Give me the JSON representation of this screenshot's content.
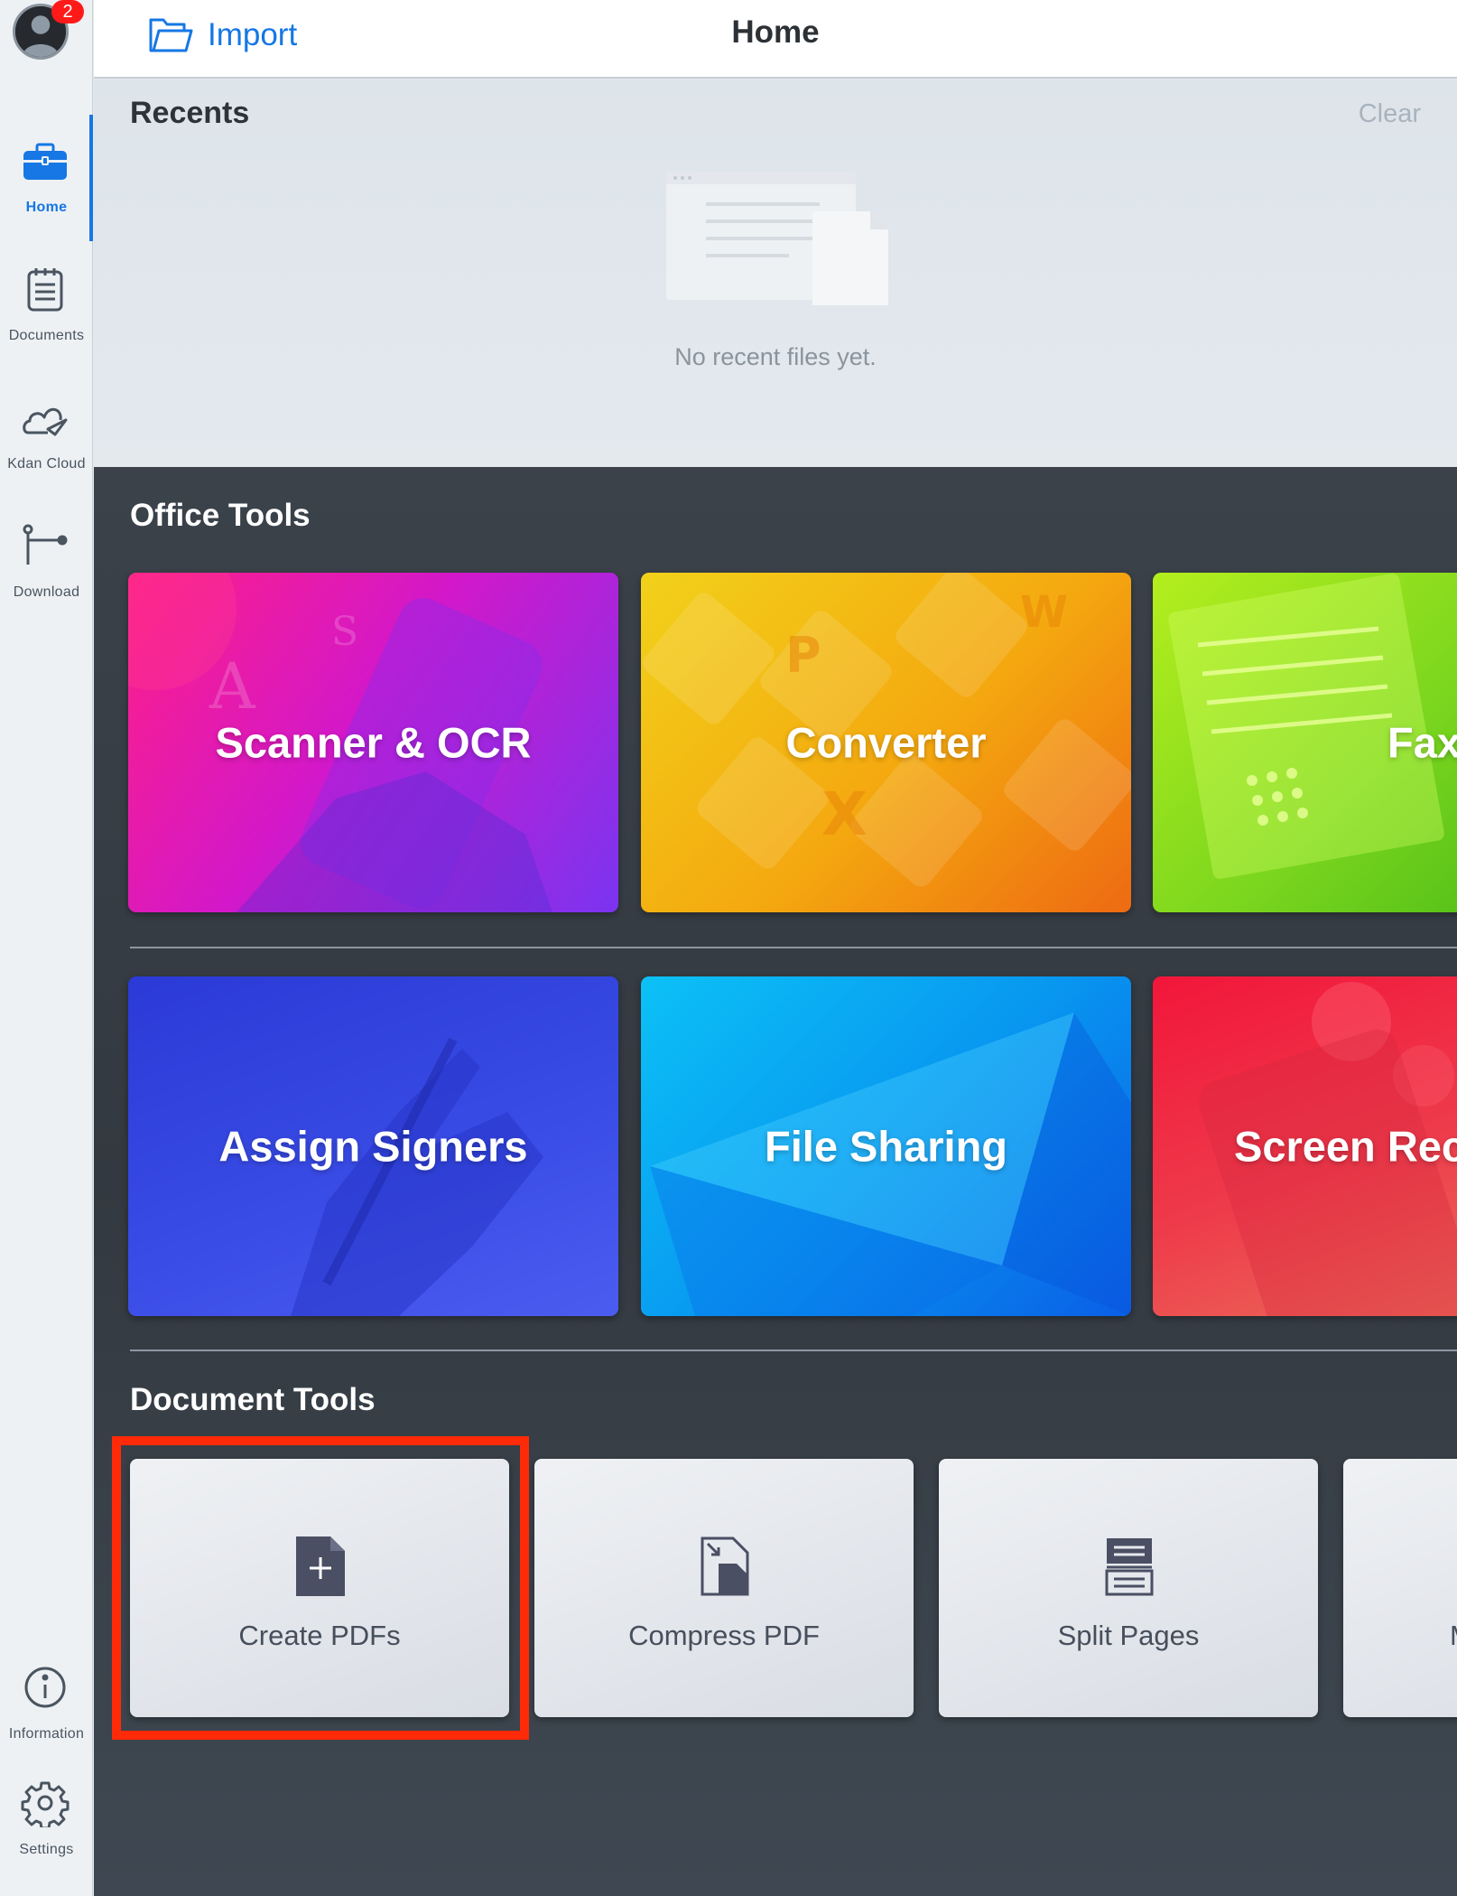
{
  "app": {
    "title": "Home",
    "accent": "#1677e5",
    "highlight_color": "#ff2a08"
  },
  "avatar": {
    "icon": "user-avatar-icon",
    "badge_count": "2"
  },
  "sidebar": {
    "items": [
      {
        "label": "Home",
        "icon": "toolbox-icon",
        "active": true
      },
      {
        "label": "Documents",
        "icon": "notepad-icon",
        "active": false
      },
      {
        "label": "Kdan Cloud",
        "icon": "cloud-icon",
        "active": false
      },
      {
        "label": "Download",
        "icon": "download-node-icon",
        "active": false
      },
      {
        "label": "Information",
        "icon": "info-icon",
        "active": false
      },
      {
        "label": "Settings",
        "icon": "gear-icon",
        "active": false
      }
    ]
  },
  "topbar": {
    "import_label": "Import",
    "import_icon": "folder-icon"
  },
  "recents": {
    "title": "Recents",
    "clear_label": "Clear",
    "empty_text": "No recent files yet."
  },
  "office_tools": {
    "title": "Office Tools",
    "cards": [
      {
        "label": "Scanner & OCR",
        "color": "#d318c9"
      },
      {
        "label": "Converter",
        "color": "#f4a80f"
      },
      {
        "label": "Fax",
        "color": "#7bd61e"
      },
      {
        "label": "Assign Signers",
        "color": "#3a4de6"
      },
      {
        "label": "File Sharing",
        "color": "#0898f0"
      },
      {
        "label": "Screen Rec",
        "color": "#ee3b4b"
      }
    ]
  },
  "document_tools": {
    "title": "Document Tools",
    "cards": [
      {
        "label": "Create PDFs",
        "icon": "create-pdf-icon"
      },
      {
        "label": "Compress PDF",
        "icon": "compress-pdf-icon"
      },
      {
        "label": "Split Pages",
        "icon": "split-pages-icon"
      },
      {
        "label": "M",
        "icon": "document-tool-icon"
      }
    ]
  }
}
